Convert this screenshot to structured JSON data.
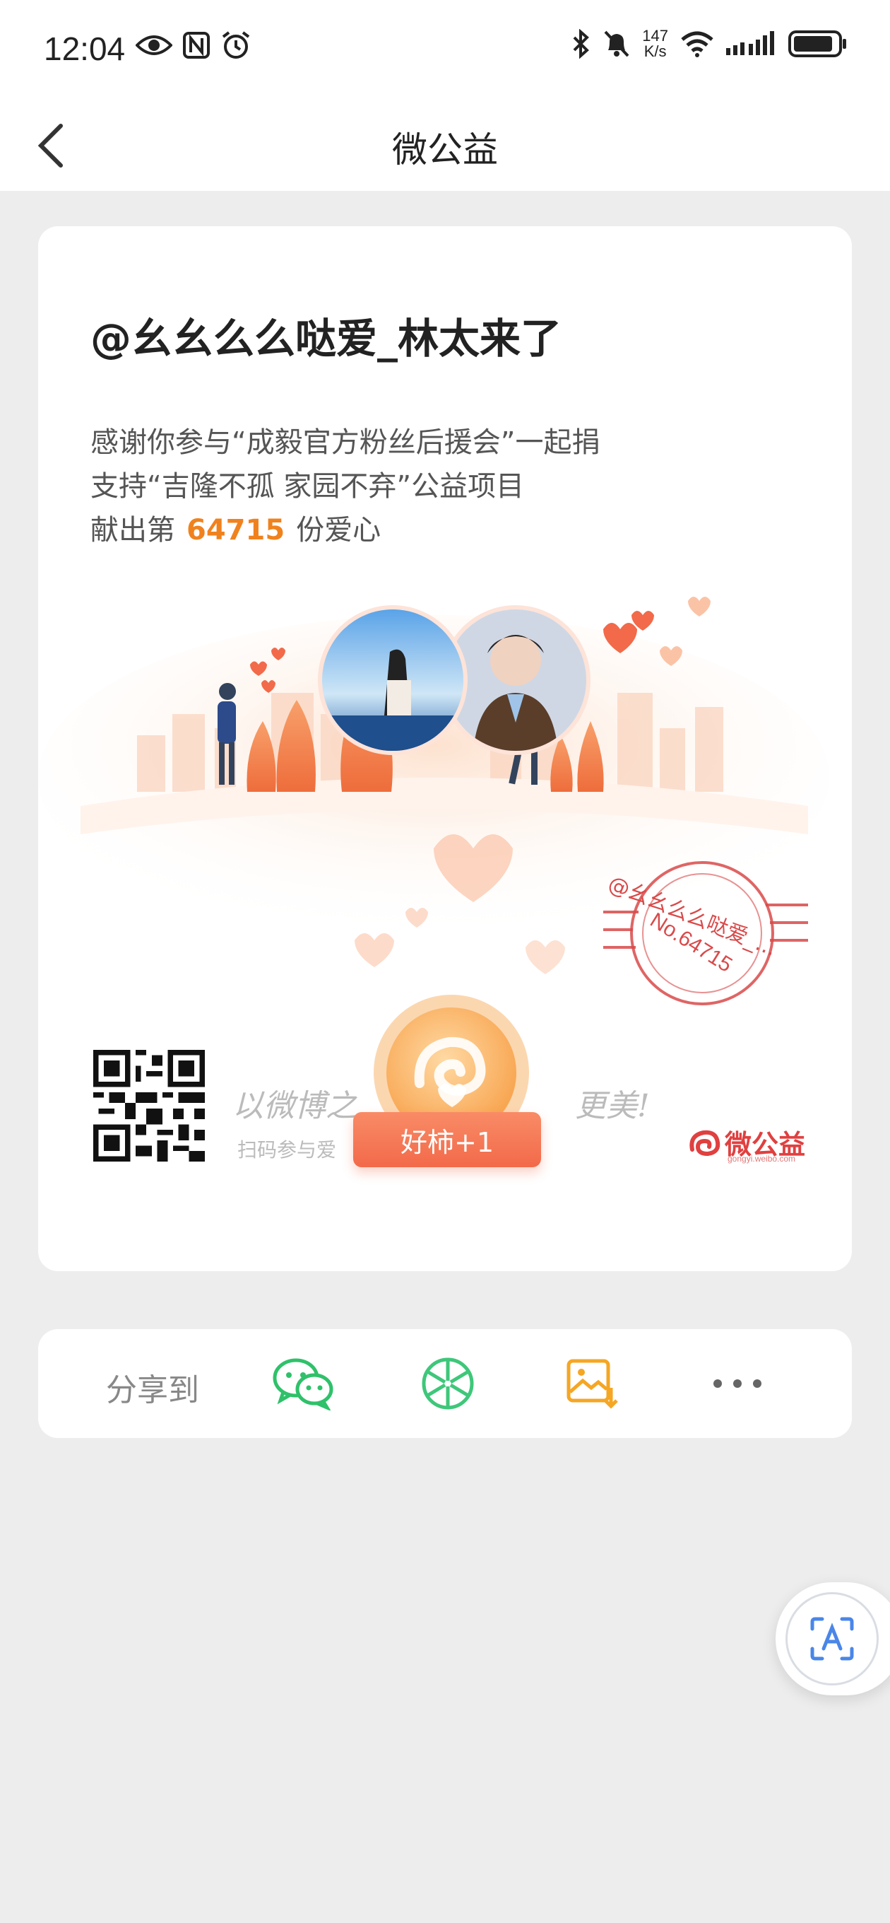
{
  "status": {
    "time": "12:04",
    "net_speed_value": "147",
    "net_speed_unit": "K/s",
    "battery_level": 0.9
  },
  "header": {
    "title": "微公益"
  },
  "card": {
    "username": "@幺幺么么哒爱_林太来了",
    "line1": "感谢你参与“成毅官方粉丝后援会”一起捐",
    "line2": "支持“吉隆不孤 家园不弃”公益项目",
    "line3_prefix": "献出第",
    "count": "64715",
    "line3_suffix": "份爱心",
    "stamp_name": "@幺幺么么哒爱_...",
    "stamp_number": "No.64715",
    "slogan_left": "以微博之",
    "slogan_right": "更美!",
    "scan_text": "扫码参与爱",
    "badge": "好柿+1",
    "brand_name": "微公益",
    "brand_url": "gongyi.weibo.com"
  },
  "share": {
    "label": "分享到",
    "targets": [
      "wechat-icon",
      "moments-icon",
      "save-image-icon",
      "more-icon"
    ]
  },
  "colors": {
    "accent": "#f0821e",
    "wechat": "#2fc16a",
    "stamp": "#d94a4a",
    "badge": "#f26a4a"
  }
}
